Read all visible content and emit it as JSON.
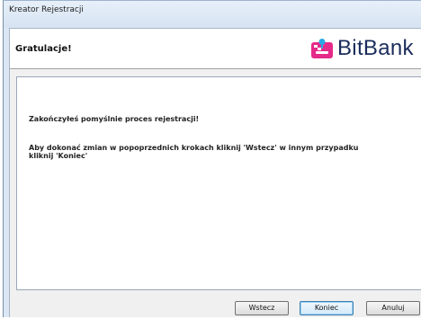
{
  "window": {
    "title": "Kreator Rejestracji"
  },
  "header": {
    "title": "Gratulacje!",
    "logo_text": "BitBank",
    "logo_icon": "bitbank-logo-icon",
    "logo_icon_color": "#e52a8a"
  },
  "content": {
    "message_1": "Zakończyłeś pomyślnie proces rejestracji!",
    "message_2": "Aby dokonać zmian w popoprzednich krokach kliknij 'Wstecz' w innym przypadku kliknij 'Koniec'"
  },
  "buttons": {
    "back": "Wstecz",
    "finish": "Koniec",
    "cancel": "Anuluj"
  }
}
